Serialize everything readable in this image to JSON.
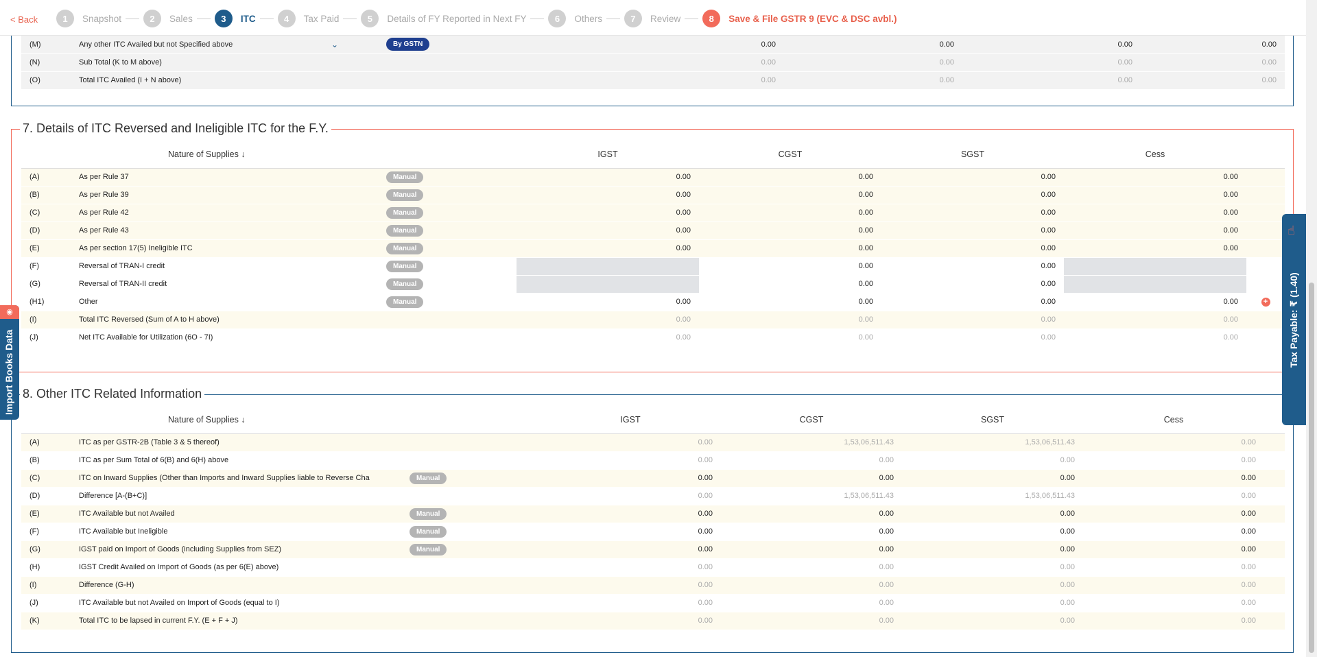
{
  "nav": {
    "back": "< Back",
    "steps": [
      {
        "n": "1",
        "label": "Snapshot"
      },
      {
        "n": "2",
        "label": "Sales"
      },
      {
        "n": "3",
        "label": "ITC"
      },
      {
        "n": "4",
        "label": "Tax Paid"
      },
      {
        "n": "5",
        "label": "Details of FY Reported in Next FY"
      },
      {
        "n": "6",
        "label": "Others"
      },
      {
        "n": "7",
        "label": "Review"
      },
      {
        "n": "8",
        "label": "Save & File GSTR 9 (EVC & DSC avbl.)"
      }
    ]
  },
  "top_rows": [
    {
      "code": "(M)",
      "desc": "Any other ITC Availed but not Specified above",
      "badge": "By GSTN",
      "vals": [
        "0.00",
        "0.00",
        "0.00",
        "0.00"
      ]
    },
    {
      "code": "(N)",
      "desc": "Sub Total (K to M above)",
      "vals": [
        "0.00",
        "0.00",
        "0.00",
        "0.00"
      ]
    },
    {
      "code": "(O)",
      "desc": "Total ITC Availed (I + N above)",
      "vals": [
        "0.00",
        "0.00",
        "0.00",
        "0.00"
      ]
    }
  ],
  "sec7": {
    "title": "7. Details of ITC Reversed and Ineligible ITC for the F.Y.",
    "headers": {
      "nature": "Nature of Supplies",
      "igst": "IGST",
      "cgst": "CGST",
      "sgst": "SGST",
      "cess": "Cess"
    },
    "manual": "Manual",
    "rows": [
      {
        "code": "(A)",
        "desc": "As per Rule 37",
        "vals": [
          "0.00",
          "0.00",
          "0.00",
          "0.00"
        ]
      },
      {
        "code": "(B)",
        "desc": "As per Rule 39",
        "vals": [
          "0.00",
          "0.00",
          "0.00",
          "0.00"
        ]
      },
      {
        "code": "(C)",
        "desc": "As per Rule 42",
        "vals": [
          "0.00",
          "0.00",
          "0.00",
          "0.00"
        ]
      },
      {
        "code": "(D)",
        "desc": "As per Rule 43",
        "vals": [
          "0.00",
          "0.00",
          "0.00",
          "0.00"
        ]
      },
      {
        "code": "(E)",
        "desc": "As per section 17(5) Ineligible ITC",
        "vals": [
          "0.00",
          "0.00",
          "0.00",
          "0.00"
        ]
      },
      {
        "code": "(F)",
        "desc": "Reversal of TRAN-I credit",
        "vals": [
          "",
          "0.00",
          "0.00",
          ""
        ]
      },
      {
        "code": "(G)",
        "desc": "Reversal of TRAN-II credit",
        "vals": [
          "",
          "0.00",
          "0.00",
          ""
        ]
      },
      {
        "code": "(H1)",
        "desc": "Other",
        "vals": [
          "0.00",
          "0.00",
          "0.00",
          "0.00"
        ]
      },
      {
        "code": "(I)",
        "desc": "Total ITC Reversed (Sum of A to H above)",
        "vals": [
          "0.00",
          "0.00",
          "0.00",
          "0.00"
        ]
      },
      {
        "code": "(J)",
        "desc": "Net ITC Available for Utilization (6O - 7I)",
        "vals": [
          "0.00",
          "0.00",
          "0.00",
          "0.00"
        ]
      }
    ]
  },
  "sec8": {
    "title": "8. Other ITC Related Information",
    "headers": {
      "nature": "Nature of Supplies",
      "igst": "IGST",
      "cgst": "CGST",
      "sgst": "SGST",
      "cess": "Cess"
    },
    "manual": "Manual",
    "rows": [
      {
        "code": "(A)",
        "desc": "ITC as per GSTR-2B (Table 3 & 5 thereof)",
        "vals": [
          "0.00",
          "1,53,06,511.43",
          "1,53,06,511.43",
          "0.00"
        ]
      },
      {
        "code": "(B)",
        "desc": "ITC as per Sum Total of 6(B) and 6(H) above",
        "vals": [
          "0.00",
          "0.00",
          "0.00",
          "0.00"
        ]
      },
      {
        "code": "(C)",
        "desc": "ITC on Inward Supplies (Other than Imports and Inward Supplies liable to Reverse Cha",
        "vals": [
          "0.00",
          "0.00",
          "0.00",
          "0.00"
        ]
      },
      {
        "code": "(D)",
        "desc": "Difference [A-(B+C)]",
        "vals": [
          "0.00",
          "1,53,06,511.43",
          "1,53,06,511.43",
          "0.00"
        ]
      },
      {
        "code": "(E)",
        "desc": "ITC Available but not Availed",
        "vals": [
          "0.00",
          "0.00",
          "0.00",
          "0.00"
        ]
      },
      {
        "code": "(F)",
        "desc": "ITC Available but Ineligible",
        "vals": [
          "0.00",
          "0.00",
          "0.00",
          "0.00"
        ]
      },
      {
        "code": "(G)",
        "desc": "IGST paid on Import of Goods (including Supplies from SEZ)",
        "vals": [
          "0.00",
          "0.00",
          "0.00",
          "0.00"
        ]
      },
      {
        "code": "(H)",
        "desc": "IGST Credit Availed on Import of Goods (as per 6(E) above)",
        "vals": [
          "0.00",
          "0.00",
          "0.00",
          "0.00"
        ]
      },
      {
        "code": "(I)",
        "desc": "Difference (G-H)",
        "vals": [
          "0.00",
          "0.00",
          "0.00",
          "0.00"
        ]
      },
      {
        "code": "(J)",
        "desc": "ITC Available but not Availed on Import of Goods (equal to I)",
        "vals": [
          "0.00",
          "0.00",
          "0.00",
          "0.00"
        ]
      },
      {
        "code": "(K)",
        "desc": "Total ITC to be lapsed in current F.Y. (E + F + J)",
        "vals": [
          "0.00",
          "0.00",
          "0.00",
          "0.00"
        ]
      }
    ]
  },
  "side": {
    "import_label": "Import Books Data",
    "tax_label": "Tax Payable: ₹ (1.40)"
  },
  "colors": {
    "accent": "#1f5c8b",
    "brand": "#f26b5b"
  }
}
